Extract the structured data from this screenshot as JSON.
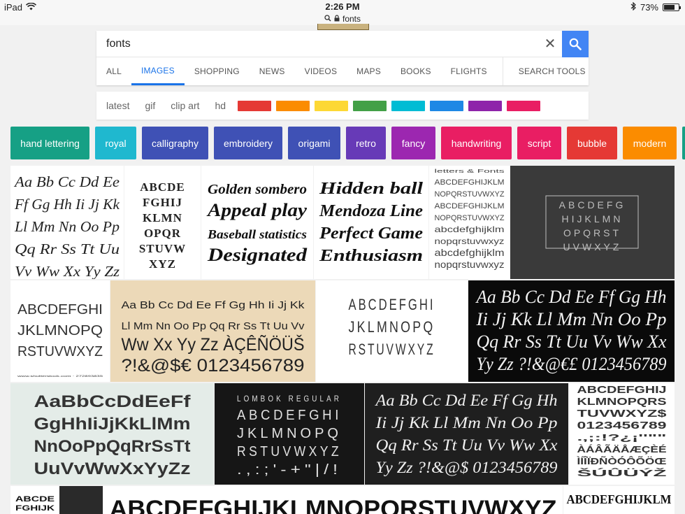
{
  "status_bar": {
    "device": "iPad",
    "time": "2:26 PM",
    "battery": "73%",
    "battery_level": 0.73
  },
  "url_bar": {
    "text": "fonts"
  },
  "search": {
    "query": "fonts"
  },
  "nav_tabs": [
    {
      "label": "ALL"
    },
    {
      "label": "IMAGES"
    },
    {
      "label": "SHOPPING"
    },
    {
      "label": "NEWS"
    },
    {
      "label": "VIDEOS"
    },
    {
      "label": "MAPS"
    },
    {
      "label": "BOOKS"
    },
    {
      "label": "FLIGHTS"
    },
    {
      "label": "SEARCH TOOLS"
    }
  ],
  "filters": [
    {
      "label": "latest"
    },
    {
      "label": "gif"
    },
    {
      "label": "clip art"
    },
    {
      "label": "hd"
    }
  ],
  "color_swatches": [
    "#e53935",
    "#fb8c00",
    "#fdd835",
    "#43a047",
    "#00bcd4",
    "#1e88e5",
    "#8e24aa",
    "#e91e63",
    "#ffffff"
  ],
  "chips": [
    {
      "label": "hand lettering",
      "color": "#16a085"
    },
    {
      "label": "royal",
      "color": "#1fb8cf"
    },
    {
      "label": "calligraphy",
      "color": "#3f51b5"
    },
    {
      "label": "embroidery",
      "color": "#3f51b5"
    },
    {
      "label": "origami",
      "color": "#3f51b5"
    },
    {
      "label": "retro",
      "color": "#673ab7"
    },
    {
      "label": "fancy",
      "color": "#9c27b0"
    },
    {
      "label": "handwriting",
      "color": "#e91e63"
    },
    {
      "label": "script",
      "color": "#e91e63"
    },
    {
      "label": "bubble",
      "color": "#e53935"
    },
    {
      "label": "modern",
      "color": "#fb8c00"
    }
  ],
  "thumbs": {
    "t1": [
      "Aa Bb Cc Dd Ee",
      "Ff Gg Hh Ii Jj Kk",
      "Ll Mm Nn Oo Pp",
      "Qq Rr Ss Tt Uu",
      "Vv Ww Xx Yy Zz"
    ],
    "t2": [
      "ABCDE",
      "FGHIJ",
      "KLMN",
      "OPQR",
      "STUVW",
      "XYZ"
    ],
    "t3": [
      "Golden sombero",
      "Appeal play",
      "Baseball statistics",
      "Designated"
    ],
    "t4": [
      "Hidden ball",
      "Mendoza Line",
      "Perfect Game",
      "Enthusiasm"
    ],
    "t5": [
      "letters & Fonts",
      "ABCDEFGHIJKLM",
      "NOPQRSTUVWXYZ",
      "ABCDEFGHIJKLM",
      "NOPQRSTUVWXYZ",
      "abcdefghijklm",
      "nopqrstuvwxyz",
      "abcdefghijklm",
      "nopqrstuvwxyz"
    ],
    "t6": [
      "ABCDEFG",
      "HIJKLMN",
      "OPQRST",
      "UVWXYZ"
    ],
    "t7": [
      "ABCDEFGHI",
      "JKLMNOPQ",
      "RSTUVWXYZ",
      "www.shutterstock.com · 272893835"
    ],
    "t8": [
      "Aa Bb Cc Dd Ee Ff Gg Hh Ii Jj Kk",
      "Ll Mm Nn Oo Pp Qq Rr Ss Tt Uu Vv",
      "Ww Xx Yy Zz ÀÇÊÑÖÜŠ",
      "?!&@$€ 0123456789"
    ],
    "t9": [
      "ABCDEFGHI",
      "JKLMNOPQ",
      "RSTUVWXYZ"
    ],
    "t10": [
      "Aa Bb Cc Dd Ee Ff Gg Hh",
      "Ii Jj Kk Ll Mm Nn Oo Pp",
      "Qq Rr Ss Tt Uu Vv Ww Xx",
      "Yy Zz ?!&@€£ 0123456789"
    ],
    "t11": [
      "AaBbCcDdEeFf",
      "GgHhIiJjKkLlMm",
      "NnOoPpQqRrSsTt",
      "UuVvWwXxYyZz"
    ],
    "t12": [
      "LOMBOK REGULAR",
      "ABCDEFGHI",
      "JKLMNOPQ",
      "RSTUVWXYZ",
      ".,:;'-+\"|/!"
    ],
    "t13": [
      "Aa Bb Cc Dd Ee Ff Gg Hh",
      "Ii Jj Kk Ll Mm Nn Oo Pp",
      "Qq Rr Ss Tt Uu Vv Ww Xx",
      "Yy Zz ?!&@$ 0123456789"
    ],
    "t14": [
      "ABCDEFGHIJ",
      "KLMNOPQRS",
      "TUVWXYZ$",
      "0123456789",
      ".,;:!?¿¡''\"\"",
      "ÀÁÂÃÄÅÆÇÈÉ",
      "ÌÍÎÏÐÑÒÓÔÕÖŒ",
      "ŠÚÛÜÝŽ"
    ],
    "t15": [
      "ABCDE",
      "FGHIJK"
    ],
    "t16": [
      "ABCDEFGHIJKLMNOPQRSTUVWXYZ"
    ],
    "t17": [
      "ABCDEFGHIJKLM"
    ]
  }
}
